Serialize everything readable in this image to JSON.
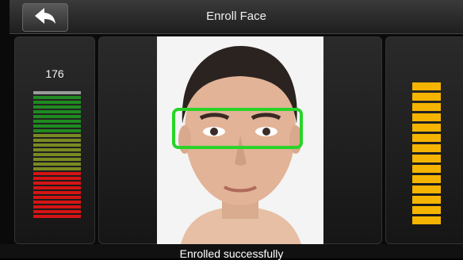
{
  "header": {
    "title": "Enroll Face",
    "back_icon": "back-arrow-icon"
  },
  "left_panel": {
    "score": "176",
    "meter_colors": [
      "#9a9a9a",
      "#1f8a1f",
      "#1f8a1f",
      "#1f8a1f",
      "#1f8a1f",
      "#1f8a1f",
      "#1f8a1f",
      "#1f8a1f",
      "#1f8a1f",
      "#7a8a22",
      "#7a8a22",
      "#7a8a22",
      "#7a8a22",
      "#7a8a22",
      "#7a8a22",
      "#7a8a22",
      "#7a8a22",
      "#d41414",
      "#d41414",
      "#d41414",
      "#d41414",
      "#d41414",
      "#d41414",
      "#d41414",
      "#d41414",
      "#d41414",
      "#d41414"
    ]
  },
  "right_panel": {
    "meter_segments": 14,
    "meter_color": "#f5b400"
  },
  "face_frame_color": "#28d428",
  "status": {
    "message": "Enrolled successfully"
  }
}
